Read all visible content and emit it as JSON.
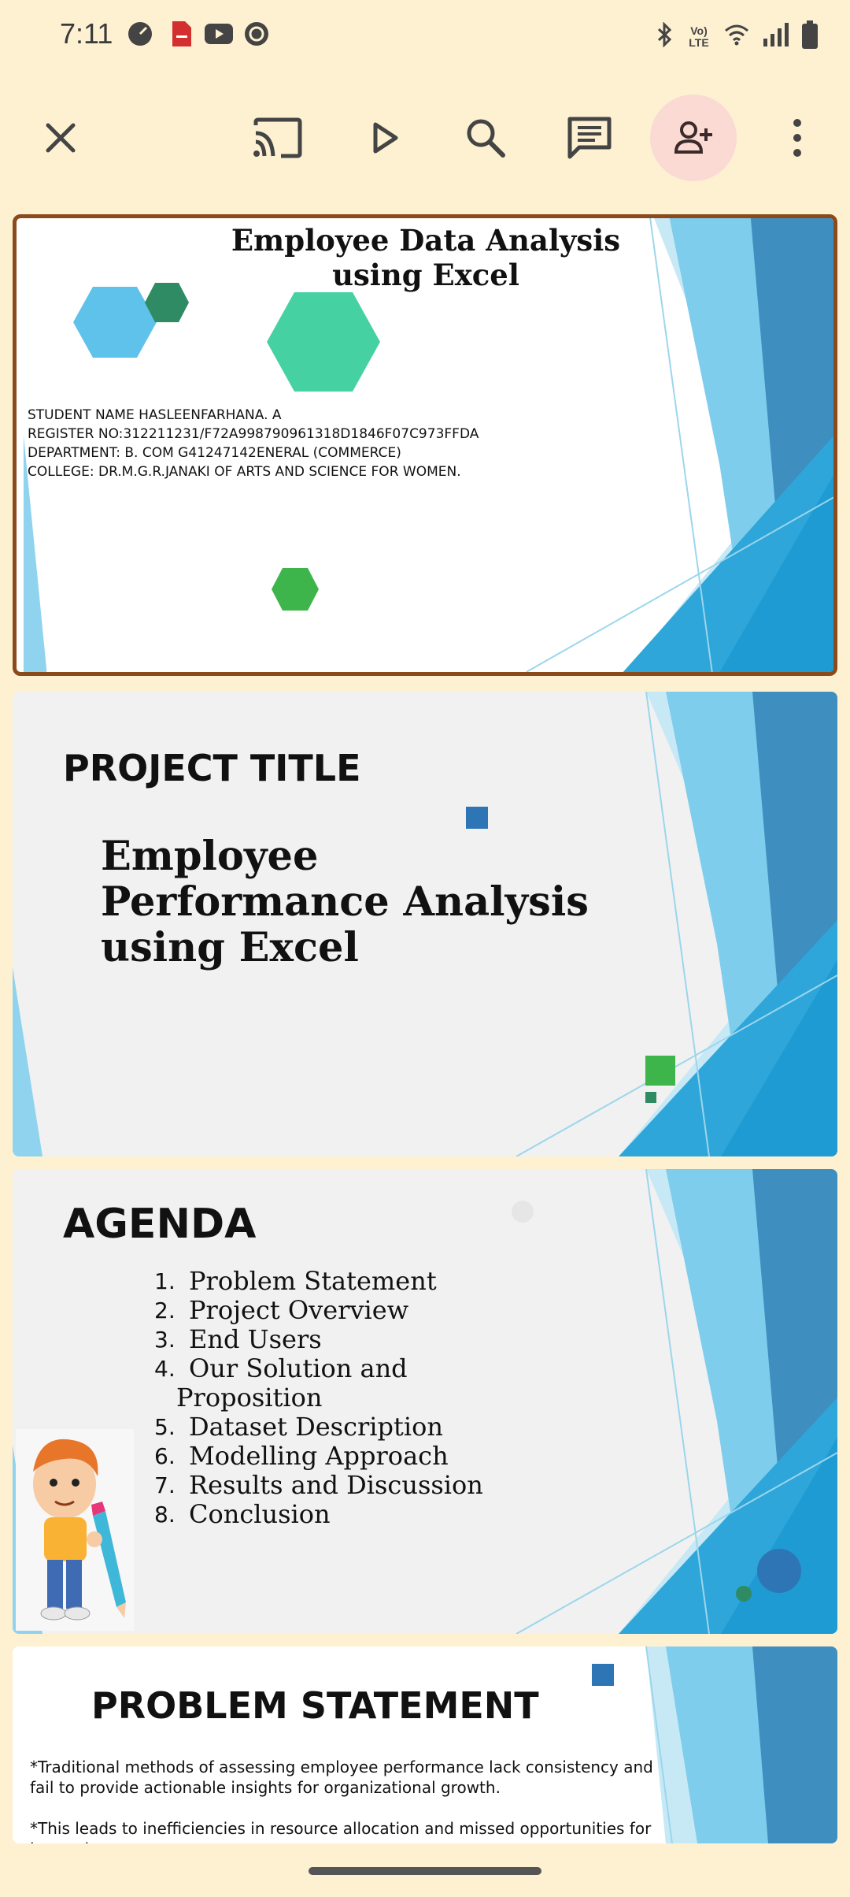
{
  "status_bar": {
    "time": "7:11",
    "icons": [
      "speed-icon",
      "pdf-icon",
      "youtube-icon",
      "record-icon",
      "bluetooth-icon",
      "volte-icon",
      "wifi-icon",
      "signal-icon",
      "battery-icon"
    ],
    "volte_label": "Vo) LTE"
  },
  "toolbar": {
    "close": "close-icon",
    "cast": "cast-icon",
    "play": "play-icon",
    "search": "search-icon",
    "comments": "comment-icon",
    "share": "add-person-icon",
    "more": "more-vert-icon",
    "share_bg": "#FADAD3"
  },
  "slides": {
    "s1": {
      "title": "Employee Data Analysis using Excel",
      "info": [
        "STUDENT NAME HASLEENFARHANA. A",
        "REGISTER NO:312211231/F72A998790961318D1846F07C973FFDA",
        "DEPARTMENT: B. COM G41247142ENERAL (COMMERCE)",
        "COLLEGE:  DR.M.G.R.JANAKI OF ARTS AND SCIENCE FOR WOMEN."
      ]
    },
    "s2": {
      "heading": "PROJECT TITLE",
      "title": "Employee Performance Analysis using Excel"
    },
    "s3": {
      "heading": "AGENDA",
      "items": [
        {
          "num": "1.",
          "text": "Problem Statement"
        },
        {
          "num": "2.",
          "text": "Project Overview"
        },
        {
          "num": "3.",
          "text": "End Users"
        },
        {
          "num": "4.",
          "text": "Our Solution and"
        },
        {
          "num": "",
          "text": "Proposition"
        },
        {
          "num": "5.",
          "text": "Dataset Description"
        },
        {
          "num": "6.",
          "text": "Modelling Approach"
        },
        {
          "num": "7.",
          "text": "Results and Discussion"
        },
        {
          "num": "8.",
          "text": "Conclusion"
        }
      ]
    },
    "s4": {
      "heading": "PROBLEM STATEMENT",
      "paragraphs": [
        "*Traditional methods of assessing employee performance lack consistency and fail to provide actionable insights for organizational growth.",
        "*This leads to inefficiencies in resource allocation and missed opportunities for improving"
      ]
    }
  },
  "colors": {
    "background": "#FDF1D2",
    "selected_border": "#8B4A1B",
    "blue_dark": "#2E75B6",
    "blue_light": "#5BC0EB",
    "green": "#3DB54A",
    "teal": "#46D1A2"
  }
}
